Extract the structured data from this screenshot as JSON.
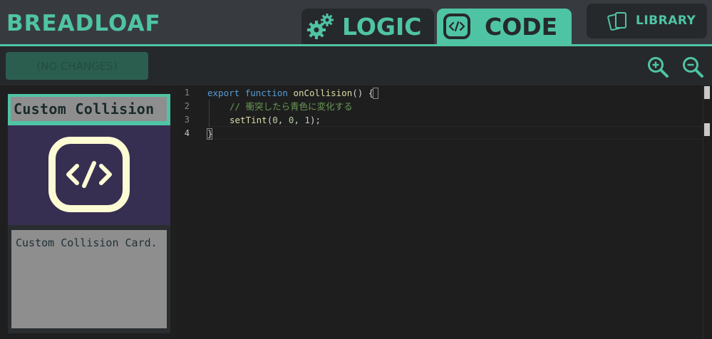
{
  "header": {
    "brand": "BREADLOAF",
    "tabs": [
      {
        "label": "LOGIC",
        "icon": "gears-icon",
        "active": false
      },
      {
        "label": "CODE",
        "icon": "code-box-icon",
        "active": true
      }
    ],
    "library_label": "LIBRARY"
  },
  "toolbar": {
    "save_label": "(NO CHANGES)",
    "zoom_in_icon": "zoom-in-icon",
    "zoom_out_icon": "zoom-out-icon"
  },
  "card": {
    "title": "Custom Collision",
    "description": "Custom Collision Card.",
    "art_icon": "code-icon"
  },
  "editor": {
    "line_numbers": [
      "1",
      "2",
      "3",
      "4"
    ],
    "active_line": "4",
    "lines": [
      {
        "kw1": "export",
        "kw2": "function",
        "name": "onCollision",
        "rest": "() {"
      },
      {
        "comment": "// 衝突したら青色に変化する"
      },
      {
        "call": "setTint",
        "open": "(",
        "a": "0",
        "sep1": ", ",
        "b": "0",
        "sep2": ", ",
        "c": "1",
        "close": ");"
      },
      {
        "text": "}"
      }
    ]
  },
  "colors": {
    "accent": "#4fc4a5",
    "header_bg": "#373b3f",
    "dark_bg": "#26292b",
    "card_art_bg": "#372f52",
    "card_gray": "#8e8e8e",
    "icon_cream": "#fdfbd3"
  }
}
